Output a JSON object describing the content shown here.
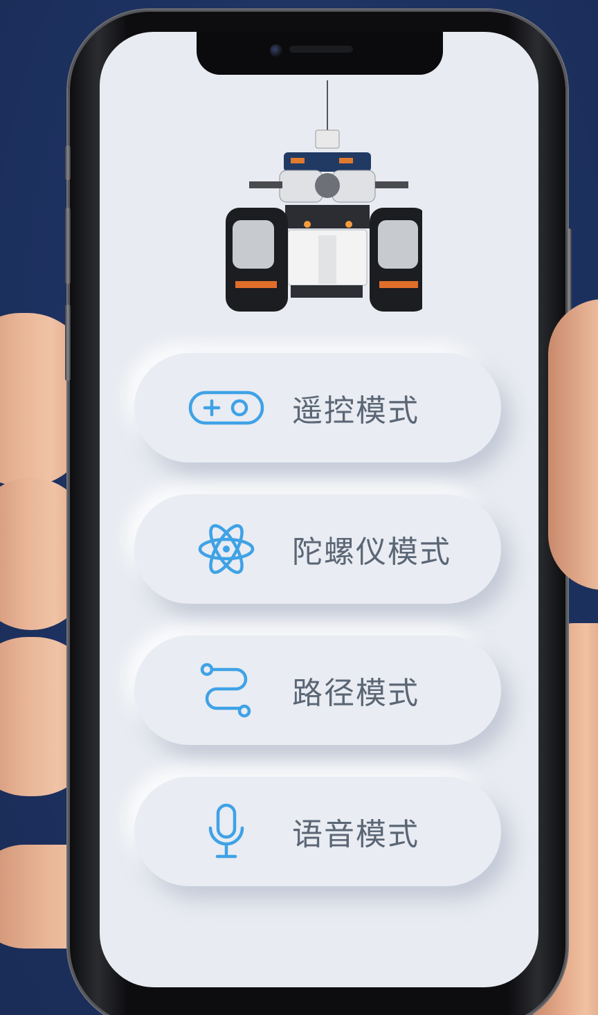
{
  "colors": {
    "background": "#1f3461",
    "screen": "#e8ebf1",
    "icon_accent": "#3fa2e6",
    "label_text": "#5b6675"
  },
  "modes": [
    {
      "label": "遥控模式",
      "icon": "gamepad-icon"
    },
    {
      "label": "陀螺仪模式",
      "icon": "atom-icon"
    },
    {
      "label": "路径模式",
      "icon": "path-icon"
    },
    {
      "label": "语音模式",
      "icon": "microphone-icon"
    }
  ]
}
